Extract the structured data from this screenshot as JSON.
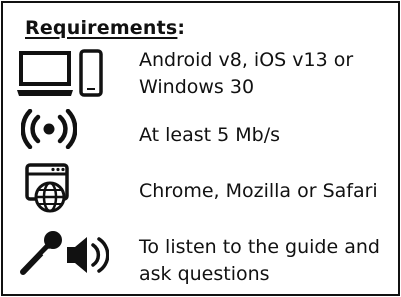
{
  "title": "Requirements",
  "title_suffix": ":",
  "items": [
    {
      "icon": "devices-icon",
      "text_lines": [
        "Android v8, iOS v13 or",
        "Windows 30"
      ]
    },
    {
      "icon": "wifi-broadcast-icon",
      "text_lines": [
        "At least 5 Mb/s"
      ]
    },
    {
      "icon": "web-browser-icon",
      "text_lines": [
        "Chrome, Mozilla or Safari"
      ]
    },
    {
      "icon": "microphone-speaker-icon",
      "text_lines": [
        "To listen to the guide and",
        "ask questions"
      ]
    }
  ],
  "colors": {
    "text": "#111111",
    "border": "#111111",
    "background": "#ffffff"
  }
}
